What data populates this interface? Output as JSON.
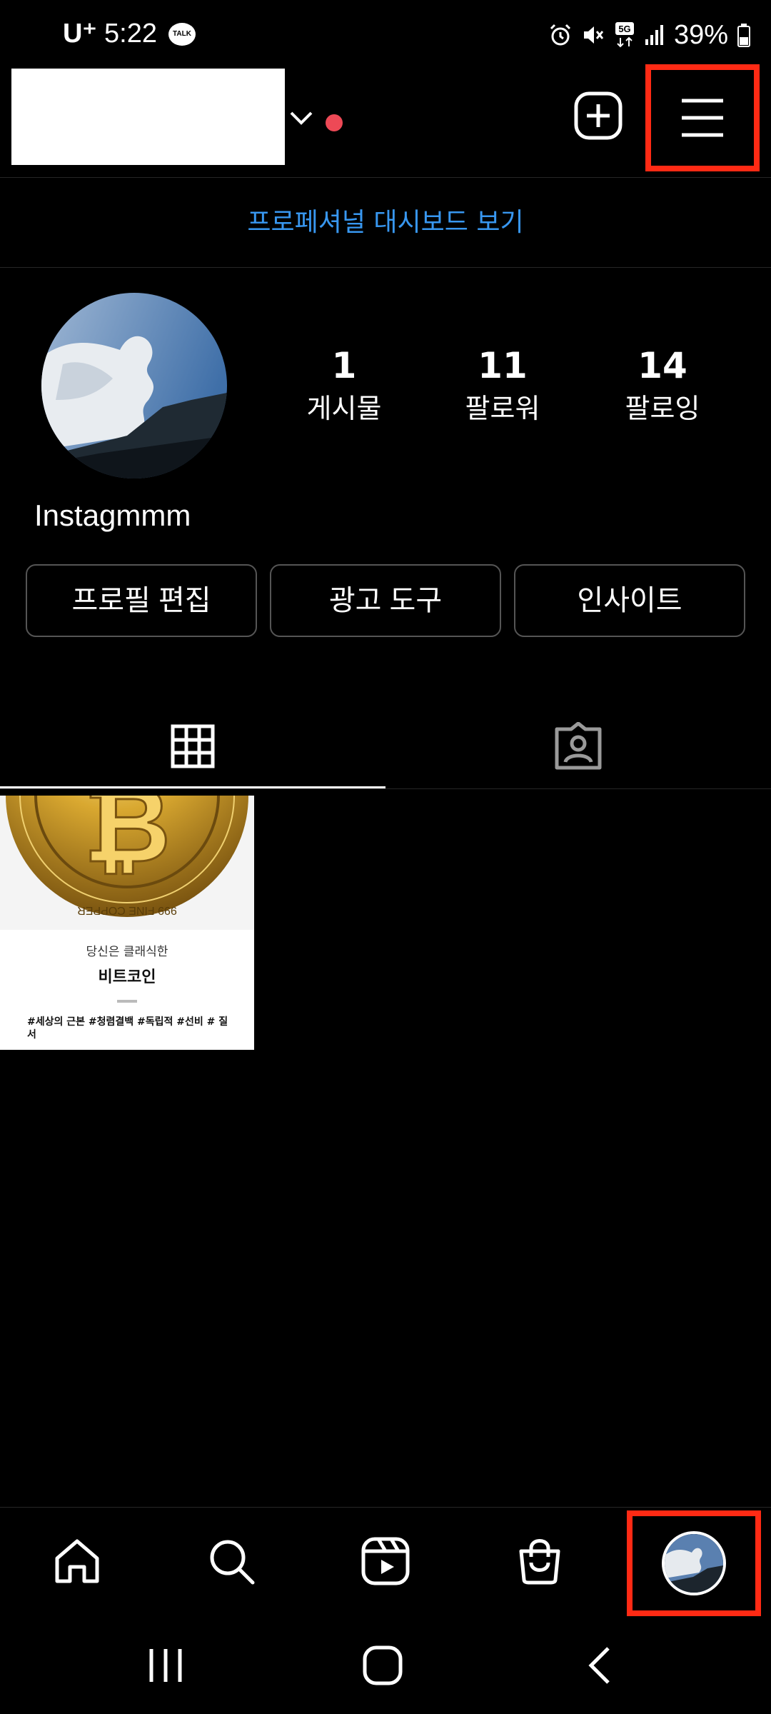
{
  "status_bar": {
    "carrier": "U⁺",
    "time": "5:22",
    "talk_badge": "TALK",
    "battery": "39%",
    "icons": [
      "alarm-icon",
      "mute-icon",
      "5g-icon",
      "signal-icon",
      "battery-icon"
    ]
  },
  "header": {
    "icons": [
      "chevron-down-icon",
      "add-post-icon",
      "menu-icon"
    ],
    "notification_color": "#ed4956",
    "highlight_color": "#ff2a14"
  },
  "dashboard": {
    "link_text": "프로페셔널 대시보드 보기",
    "color": "#3897f0"
  },
  "profile": {
    "name": "Instagmmm",
    "stats": [
      {
        "value": "1",
        "label": "게시물"
      },
      {
        "value": "11",
        "label": "팔로워"
      },
      {
        "value": "14",
        "label": "팔로잉"
      }
    ],
    "buttons": [
      "프로필 편집",
      "광고 도구",
      "인사이트"
    ]
  },
  "tabs": [
    {
      "icon": "grid-icon",
      "active": true
    },
    {
      "icon": "tagged-person-icon",
      "active": false
    }
  ],
  "posts": [
    {
      "subtitle": "당신은 클래식한",
      "title": "비트코인",
      "tags": "#세상의 근본 #청렴결백 #독립적 #선비 # 질서",
      "coin_text": "999 FINE COPPER"
    }
  ],
  "bottom_nav": [
    "home-icon",
    "search-icon",
    "reels-icon",
    "shop-icon",
    "profile-avatar"
  ],
  "system_nav": [
    "recents-icon",
    "home-button-icon",
    "back-icon"
  ]
}
